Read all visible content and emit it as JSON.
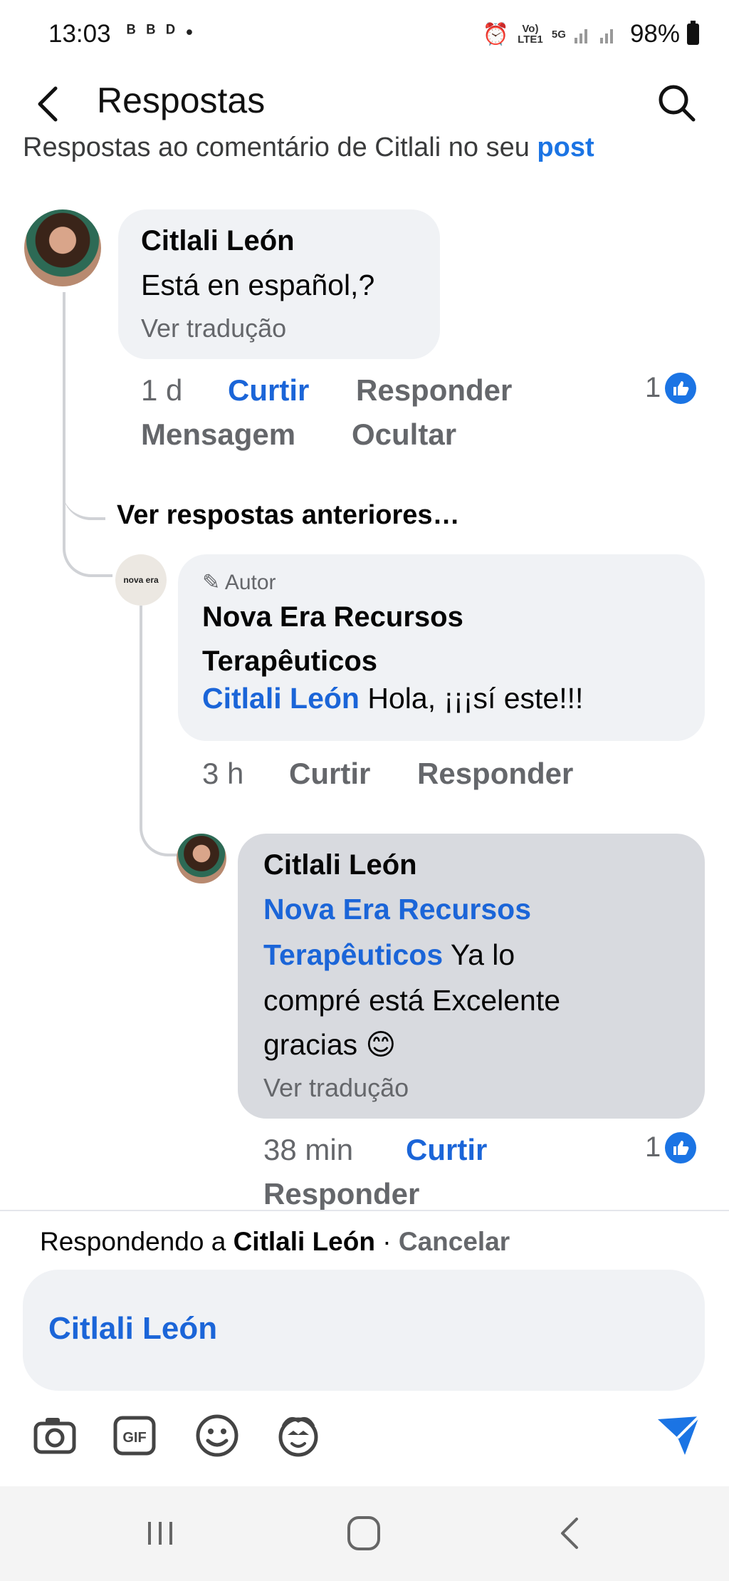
{
  "status_bar": {
    "time": "13:03",
    "notifications": "ᴮ ᴮ ᴰ •",
    "network_top": "Vo) LTE1",
    "network_5g": "5G",
    "battery": "98%"
  },
  "app_bar": {
    "title": "Respostas"
  },
  "subheader": {
    "text": "Respostas ao comentário de Citlali no seu",
    "link": "post"
  },
  "comment": {
    "author": "Citlali León",
    "text": "Está en español,?",
    "translate": "Ver tradução",
    "time": "1 d",
    "like": "Curtir",
    "reply": "Responder",
    "message": "Mensagem",
    "hide": "Ocultar",
    "likes_count": "1"
  },
  "view_previous": "Ver respostas anteriores…",
  "reply1": {
    "author_badge": "Autor",
    "author": "Nova Era Recursos Terapêuticos",
    "author_line1": "Nova Era Recursos",
    "author_line2": "Terapêuticos",
    "mention": "Citlali León",
    "text": "Hola, ¡¡¡sí este!!!",
    "time": "3 h",
    "like": "Curtir",
    "reply": "Responder",
    "logo_text": "nova era"
  },
  "reply2": {
    "author": "Citlali León",
    "mention_line1": "Nova Era Recursos",
    "mention_line2": "Terapêuticos",
    "text_line2": "Ya lo",
    "text_line3": "compré está Excelente",
    "text_line4": "gracias 😊",
    "translate": "Ver tradução",
    "time": "38 min",
    "like": "Curtir",
    "reply": "Responder",
    "likes_count": "1"
  },
  "composer": {
    "replying_prefix": "Respondendo a",
    "replying_name": "Citlali León",
    "separator": "·",
    "cancel": "Cancelar",
    "mention": "Citlali León"
  },
  "toolbar": {
    "icons": [
      "camera-icon",
      "gif-icon",
      "emoji-icon",
      "sticker-icon",
      "send-icon"
    ],
    "accent": "#1b74e4"
  }
}
